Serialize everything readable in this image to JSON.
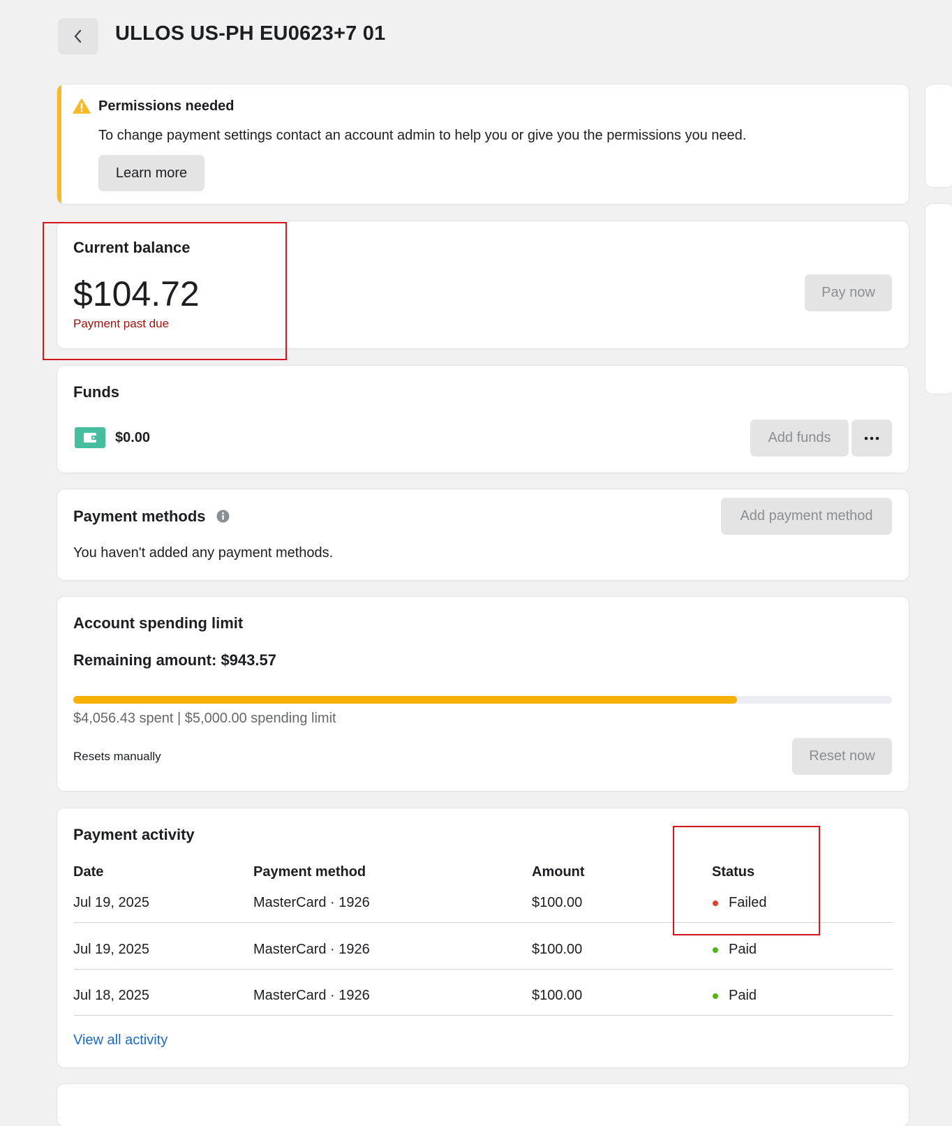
{
  "header": {
    "title": "ULLOS US-PH EU0623+7 01",
    "back_icon": "chevron-left-icon"
  },
  "permissions": {
    "title": "Permissions needed",
    "message": "To change payment settings contact an account admin to help you or give you the permissions you need.",
    "learn_more_label": "Learn more",
    "icon": "warning-icon",
    "accent_color": "#f7b928"
  },
  "balance": {
    "title": "Current balance",
    "amount": "$104.72",
    "status": "Payment past due",
    "status_color": "#a1120c",
    "pay_now_label": "Pay now"
  },
  "funds": {
    "title": "Funds",
    "amount": "$0.00",
    "add_funds_label": "Add funds",
    "icon": "wallet-icon",
    "more_icon": "more-horizontal-icon"
  },
  "payment_methods": {
    "title": "Payment methods",
    "info_icon": "info-icon",
    "add_label": "Add payment method",
    "empty_message": "You haven't added any payment methods."
  },
  "spending_limit": {
    "title": "Account spending limit",
    "remaining": "Remaining amount: $943.57",
    "progress_fraction": 0.811,
    "progress_color": "#f7b100",
    "summary": "$4,056.43 spent | $5,000.00 spending limit",
    "reset_note": "Resets manually",
    "reset_label": "Reset now"
  },
  "activity": {
    "title": "Payment activity",
    "columns": [
      "Date",
      "Payment method",
      "Amount",
      "Status"
    ],
    "rows": [
      {
        "date": "Jul 19, 2025",
        "method": "MasterCard · 1926",
        "amount": "$100.00",
        "status": "Failed",
        "status_color": "#e0412c"
      },
      {
        "date": "Jul 19, 2025",
        "method": "MasterCard · 1926",
        "amount": "$100.00",
        "status": "Paid",
        "status_color": "#52b418"
      },
      {
        "date": "Jul 18, 2025",
        "method": "MasterCard · 1926",
        "amount": "$100.00",
        "status": "Paid",
        "status_color": "#52b418"
      }
    ],
    "view_all_label": "View all activity",
    "link_color": "#1d6ac2"
  }
}
